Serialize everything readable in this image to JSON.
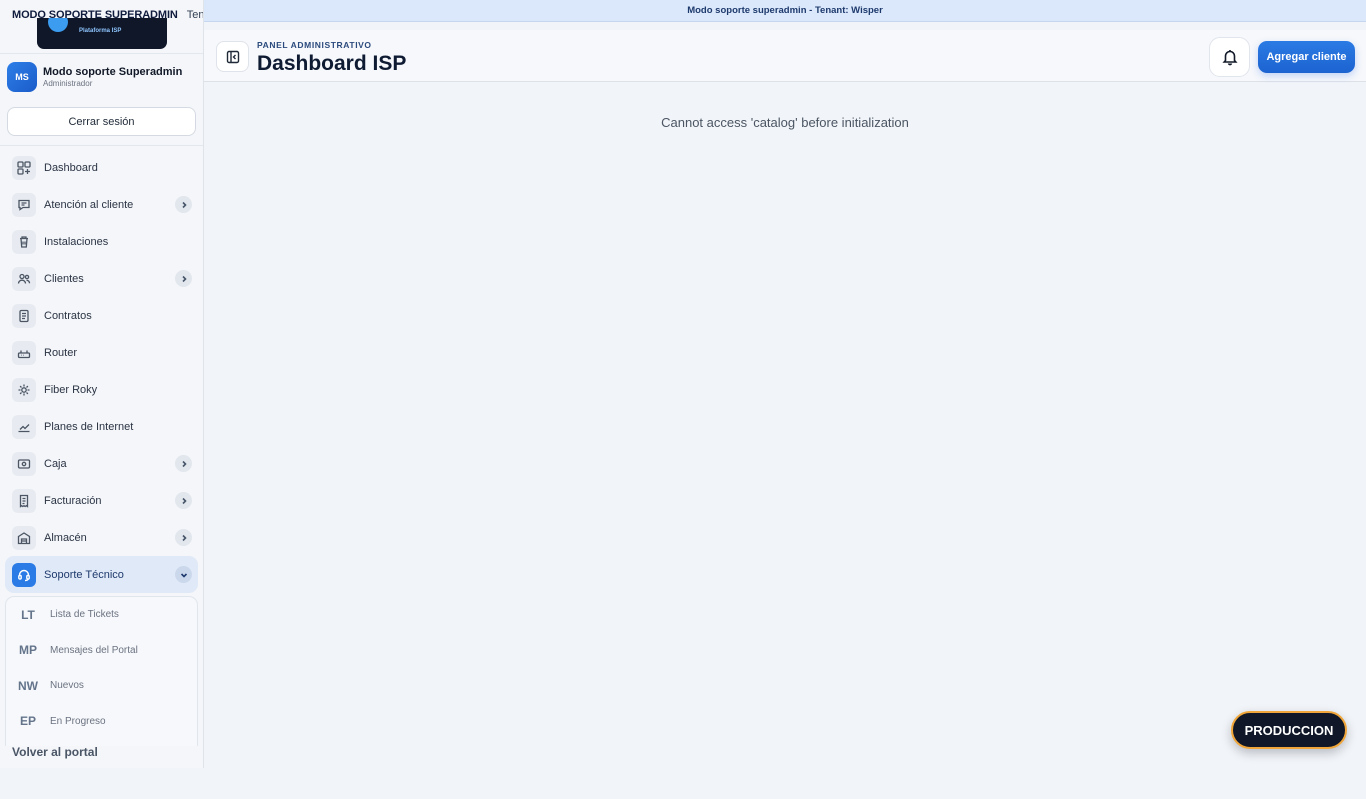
{
  "top": {
    "mode_label": "MODO SOPORTE SUPERADMIN",
    "tenant_label": "Tenant: Wisper",
    "banner_text": "Modo soporte superadmin - Tenant: Wisper"
  },
  "logo": {
    "text": "Plataforma ISP"
  },
  "user": {
    "initials": "MS",
    "name": "Modo soporte Superadmin",
    "role": "Administrador",
    "logout_label": "Cerrar sesión"
  },
  "nav": [
    {
      "label": "Dashboard",
      "icon": "grid-icon",
      "has_chevron": false
    },
    {
      "label": "Atención al cliente",
      "icon": "message-icon",
      "has_chevron": true
    },
    {
      "label": "Instalaciones",
      "icon": "installation-icon",
      "has_chevron": false
    },
    {
      "label": "Clientes",
      "icon": "users-icon",
      "has_chevron": true
    },
    {
      "label": "Contratos",
      "icon": "document-icon",
      "has_chevron": false
    },
    {
      "label": "Router",
      "icon": "router-icon",
      "has_chevron": false
    },
    {
      "label": "Fiber Roky",
      "icon": "sun-icon",
      "has_chevron": false
    },
    {
      "label": "Planes de Internet",
      "icon": "speed-icon",
      "has_chevron": false
    },
    {
      "label": "Caja",
      "icon": "cash-icon",
      "has_chevron": true
    },
    {
      "label": "Facturación",
      "icon": "receipt-icon",
      "has_chevron": true
    },
    {
      "label": "Almacén",
      "icon": "warehouse-icon",
      "has_chevron": true
    },
    {
      "label": "Soporte Técnico",
      "icon": "headset-icon",
      "has_chevron": true,
      "active": true,
      "expanded": true
    }
  ],
  "submenu": [
    {
      "abbr": "LT",
      "label": "Lista de Tickets"
    },
    {
      "abbr": "MP",
      "label": "Mensajes del Portal"
    },
    {
      "abbr": "NW",
      "label": "Nuevos"
    },
    {
      "abbr": "EP",
      "label": "En Progreso"
    }
  ],
  "back_portal_label": "Volver al portal",
  "header": {
    "kicker": "PANEL ADMINISTRATIVO",
    "title": "Dashboard ISP",
    "add_client_label": "Agregar cliente"
  },
  "main": {
    "error_text": "Cannot access 'catalog' before initialization"
  },
  "env_badge": "PRODUCCION",
  "colors": {
    "accent": "#2a7be6",
    "banner_bg": "#dbe8fb",
    "badge_border": "#f0a63a",
    "dark": "#0f1728"
  }
}
